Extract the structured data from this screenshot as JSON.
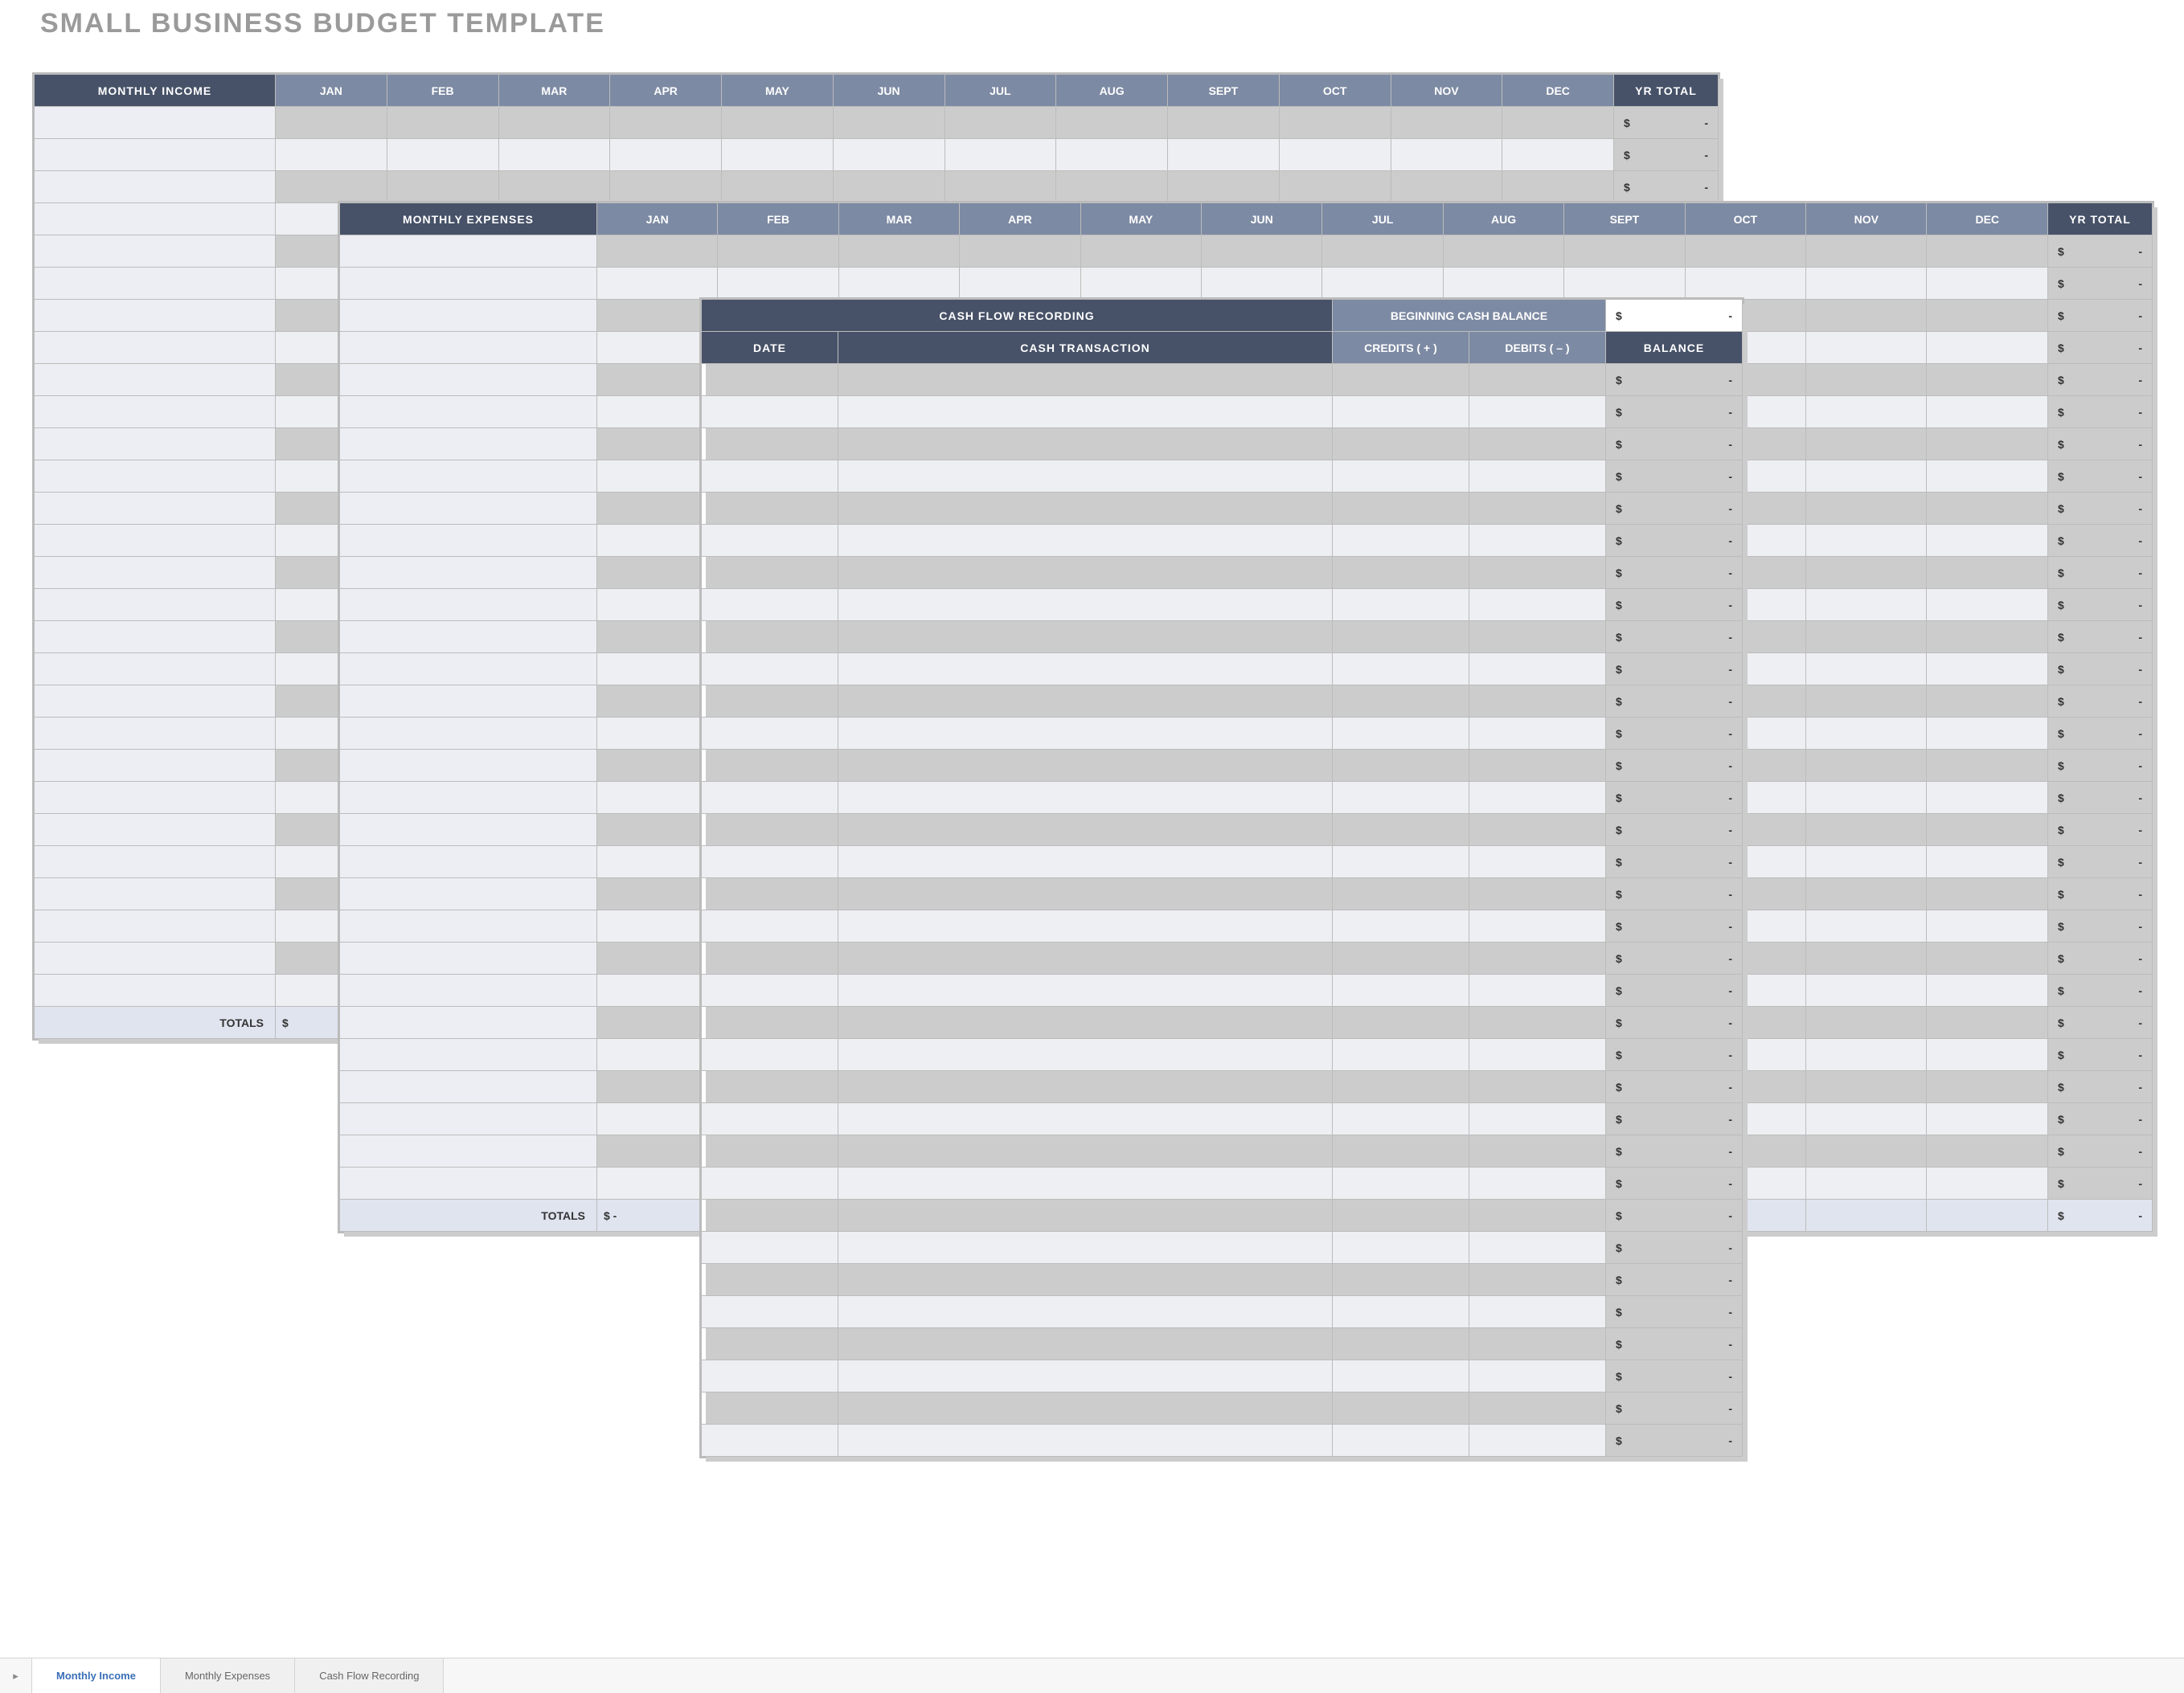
{
  "title": "SMALL BUSINESS BUDGET TEMPLATE",
  "months": [
    "JAN",
    "FEB",
    "MAR",
    "APR",
    "MAY",
    "JUN",
    "JUL",
    "AUG",
    "SEPT",
    "OCT",
    "NOV",
    "DEC"
  ],
  "yr_total": "YR TOTAL",
  "income": {
    "header": "MONTHLY INCOME",
    "rows": 28,
    "totals_label": "TOTALS",
    "totals_first": "$"
  },
  "expenses": {
    "header": "MONTHLY EXPENSES",
    "rows": 30,
    "totals_label": "TOTALS",
    "totals_first": "$           -"
  },
  "cashflow": {
    "title": "CASH FLOW RECORDING",
    "begin_label": "BEGINNING CASH BALANCE",
    "cols": {
      "date": "DATE",
      "tx": "CASH TRANSACTION",
      "credits": "CREDITS ( + )",
      "debits": "DEBITS ( – )",
      "balance": "BALANCE"
    },
    "rows": 34
  },
  "money_placeholder": {
    "currency": "$",
    "value": "-"
  },
  "tabs": {
    "items": [
      "Monthly Income",
      "Monthly Expenses",
      "Cash Flow Recording"
    ],
    "active": 0,
    "nav_glyph": "▸"
  }
}
